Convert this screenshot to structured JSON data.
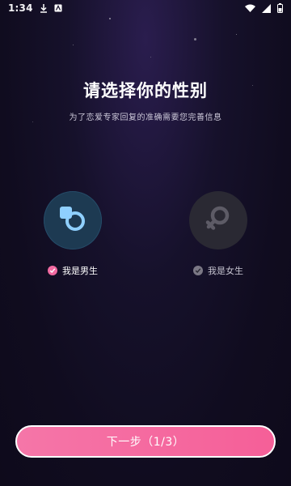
{
  "status_bar": {
    "time": "1:34",
    "icons": [
      "download-icon",
      "app-notification-icon",
      "wifi-icon",
      "signal-icon",
      "battery-icon"
    ]
  },
  "header": {
    "title": "请选择你的性别",
    "subtitle": "为了恋爱专家回复的准确需要您完善信息"
  },
  "options": {
    "male": {
      "label": "我是男生",
      "selected": true,
      "icon": "male-icon"
    },
    "female": {
      "label": "我是女生",
      "selected": false,
      "icon": "female-icon"
    }
  },
  "next_button": {
    "label": "下一步（1/3）"
  },
  "colors": {
    "accent_pink": "#f16aa1",
    "button_gradient_start": "#f576a8",
    "male_icon_blue": "#8fd0ff"
  }
}
